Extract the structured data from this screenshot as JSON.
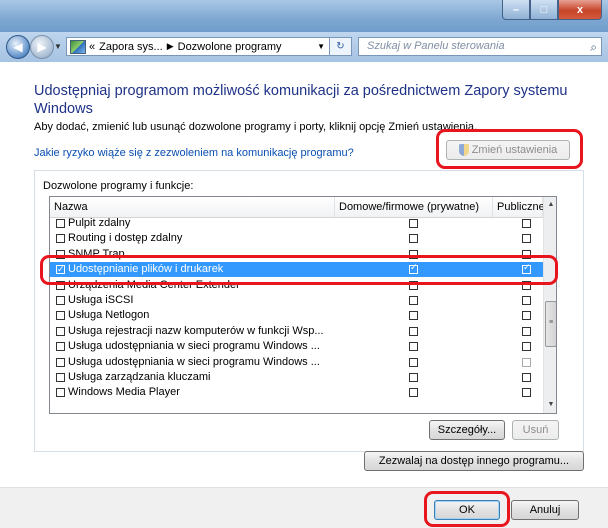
{
  "window": {
    "min": "–",
    "max": "□",
    "close": "x"
  },
  "addressbar": {
    "back_glyph": "◀",
    "fwd_glyph": "▶",
    "crumb_prefix": "«",
    "crumb1": "Zapora sys...",
    "sep": "▶",
    "crumb2": "Dozwolone programy",
    "drop": "▼",
    "refresh": "↻",
    "search_placeholder": "Szukaj w Panelu sterowania",
    "search_icon": "⌕"
  },
  "main": {
    "heading": "Udostępniaj programom możliwość komunikacji za pośrednictwem Zapory systemu Windows",
    "description": "Aby dodać, zmienić lub usunąć dozwolone programy i porty, kliknij opcję Zmień ustawienia.",
    "risk_link": "Jakie ryzyko wiąże się z zezwoleniem na komunikację programu?",
    "change_settings": "Zmień ustawienia",
    "group_label": "Dozwolone programy i funkcje:",
    "columns": {
      "name": "Nazwa",
      "home": "Domowe/firmowe (prywatne)",
      "public": "Publiczne"
    },
    "rows": [
      {
        "name": "Pulpit zdalny",
        "checked": false,
        "home": false,
        "public": false
      },
      {
        "name": "Routing i dostęp zdalny",
        "checked": false,
        "home": false,
        "public": false
      },
      {
        "name": "SNMP Trap",
        "checked": false,
        "home": false,
        "public": false
      },
      {
        "name": "Udostępnianie plików i drukarek",
        "checked": true,
        "home": true,
        "public": true,
        "selected": true
      },
      {
        "name": "Urządzenia Media Center Extender",
        "checked": false,
        "home": false,
        "public": false
      },
      {
        "name": "Usługa iSCSI",
        "checked": false,
        "home": false,
        "public": false
      },
      {
        "name": "Usługa Netlogon",
        "checked": false,
        "home": false,
        "public": false
      },
      {
        "name": "Usługa rejestracji nazw komputerów w funkcji Wsp...",
        "checked": false,
        "home": false,
        "public": false
      },
      {
        "name": "Usługa udostępniania w sieci programu Windows ...",
        "checked": false,
        "home": false,
        "public": false
      },
      {
        "name": "Usługa udostępniania w sieci programu Windows ...",
        "checked": false,
        "home": false,
        "public": false,
        "dim_public": true
      },
      {
        "name": "Usługa zarządzania kluczami",
        "checked": false,
        "home": false,
        "public": false
      },
      {
        "name": "Windows Media Player",
        "checked": false,
        "home": false,
        "public": false
      }
    ],
    "details_button": "Szczegóły...",
    "remove_button": "Usuń",
    "allow_other_button": "Zezwalaj na dostęp innego programu...",
    "scroll_up": "▲",
    "scroll_down": "▼",
    "scroll_grip": "≡"
  },
  "footer": {
    "ok": "OK",
    "cancel": "Anuluj"
  },
  "colors": {
    "highlight": "#e8141e",
    "selection": "#3399ff",
    "link": "#0a4fb2",
    "heading": "#1e3287"
  }
}
